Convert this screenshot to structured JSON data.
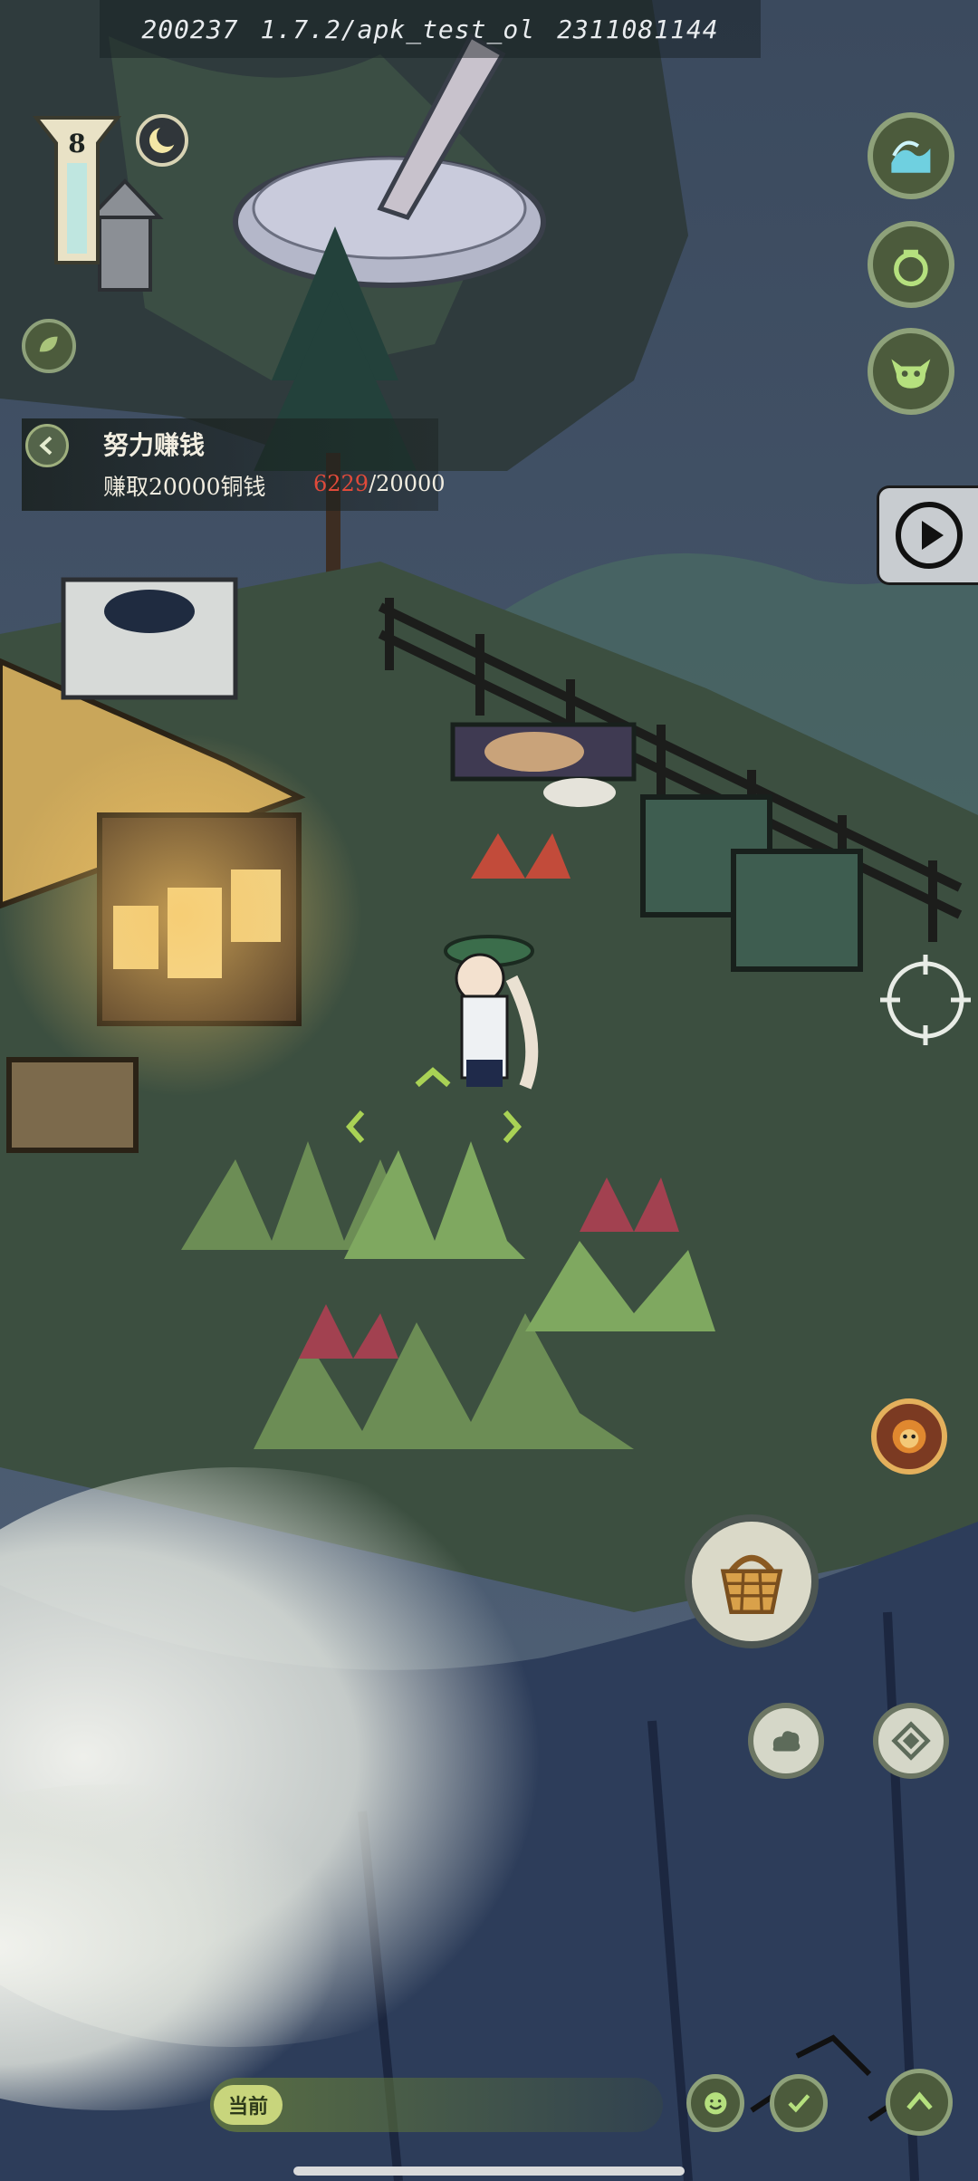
{
  "header": {
    "build_id": "200237",
    "version": "1.7.2/apk_test_ol",
    "build_code": "2311081144"
  },
  "player": {
    "level": "8"
  },
  "quest": {
    "title": "努力赚钱",
    "description": "赚取20000铜钱",
    "progress_current": "6229",
    "progress_total": "/20000"
  },
  "chat": {
    "channel_label": "当前"
  },
  "icons": {
    "top_right": [
      "wave-icon",
      "pouch-icon",
      "ox-mask-icon"
    ],
    "video": "play-icon",
    "boss": "lion-face-icon",
    "basket": "basket-icon",
    "cloud": "cloud-icon",
    "compass": "diamond-compass-icon",
    "emoji": "smiley-icon",
    "edit": "brush-check-icon",
    "expand": "chevron-up-icon",
    "crosshair": "crosshair-icon"
  },
  "colors": {
    "progress_current": "#e04a3a",
    "accent_green": "#a9d255",
    "button_ring": "#8ea17a"
  }
}
